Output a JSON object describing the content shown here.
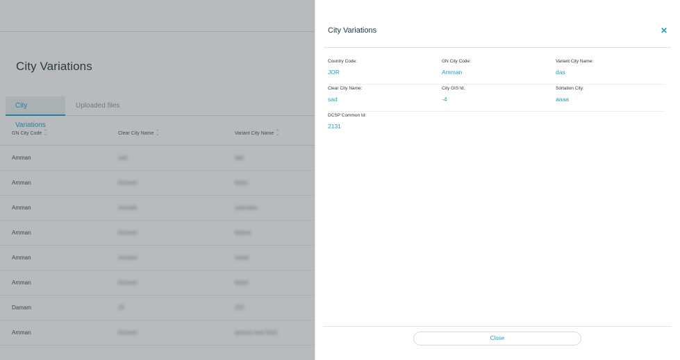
{
  "page": {
    "title": "City Variations",
    "tabs": [
      {
        "label": "City Variations",
        "active": true
      },
      {
        "label": "Uploaded files",
        "active": false
      }
    ],
    "table": {
      "columns": [
        "GN City Code",
        "Clear City Name",
        "Variant City Name"
      ],
      "rows": [
        {
          "gn": "Amman",
          "clear": "sad",
          "variant": "das"
        },
        {
          "gn": "Amman",
          "clear": "Ammen",
          "variant": "testvi"
        },
        {
          "gn": "Amman",
          "clear": "Ammah",
          "variant": "yasmeen"
        },
        {
          "gn": "Amman",
          "clear": "Ammen",
          "variant": "testvar"
        },
        {
          "gn": "Amman",
          "clear": "Ammen",
          "variant": "mzed"
        },
        {
          "gn": "Amman",
          "clear": "Ammen",
          "variant": "testvt"
        },
        {
          "gn": "Damam",
          "clear": "22",
          "variant": "222"
        },
        {
          "gn": "Amman",
          "clear": "Ammen",
          "variant": "ammon test 0101"
        }
      ]
    }
  },
  "drawer": {
    "title": "City Variations",
    "close_icon": "close-x-icon",
    "fields": [
      {
        "label": "Country Code:",
        "value": "JOR"
      },
      {
        "label": "GN City Code:",
        "value": "Amman"
      },
      {
        "label": "Variant City Name:",
        "value": "das"
      },
      {
        "label": "Clear City Name:",
        "value": "sad"
      },
      {
        "label": "City GIS Id:",
        "value": "-4"
      },
      {
        "label": "Sortation City:",
        "value": "aaaa"
      },
      {
        "label": "DCSP Common Id:",
        "value": "2131"
      }
    ],
    "close_button": "Close"
  },
  "colors": {
    "accent": "#1aa0c2",
    "title_text": "#1d3640",
    "overlay": "rgba(60,66,70,0.33)"
  }
}
